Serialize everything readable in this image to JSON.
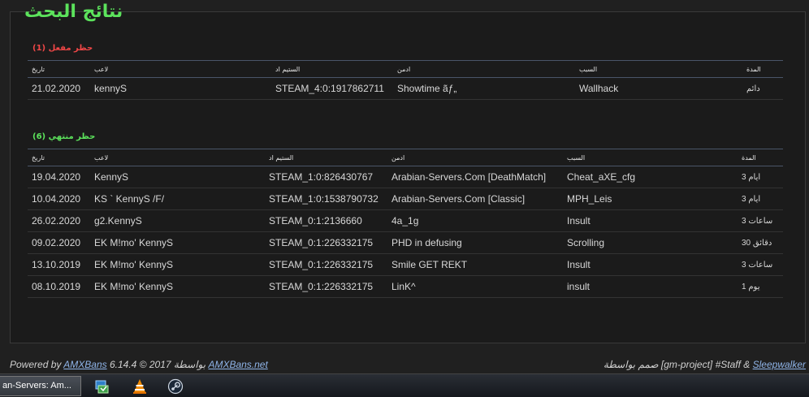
{
  "page_title": "نتائج البحث",
  "active_bans": {
    "title": "حظر مفعل (1)",
    "headers": [
      "تاريخ",
      "لاعب",
      "الستيم اد",
      "ادمن",
      "السبب",
      "المدة"
    ],
    "rows": [
      [
        "21.02.2020",
        "kennyS",
        "STEAM_4:0:1917862711",
        "Showtime ãƒ„",
        "Wallhack",
        "دائم"
      ]
    ]
  },
  "expired_bans": {
    "title": "حظر منتهي (6)",
    "headers": [
      "تاريخ",
      "لاعب",
      "الستيم اد",
      "ادمن",
      "السبب",
      "المدة"
    ],
    "rows": [
      [
        "19.04.2020",
        "KennyS",
        "STEAM_1:0:826430767",
        "Arabian-Servers.Com [DeathMatch]",
        "Cheat_aXE_cfg",
        "ايام 3"
      ],
      [
        "10.04.2020",
        "KS ` KennyS /F/",
        "STEAM_1:0:1538790732",
        "Arabian-Servers.Com [Classic]",
        "MPH_Leis",
        "ايام 3"
      ],
      [
        "26.02.2020",
        "g2.KennyS",
        "STEAM_0:1:2136660",
        "4a_1g",
        "Insult",
        "ساعات 3"
      ],
      [
        "09.02.2020",
        "EK M!mo' KennyS",
        "STEAM_0:1:226332175",
        "PHD in defusing",
        "Scrolling",
        "دقائق 30"
      ],
      [
        "13.10.2019",
        "EK M!mo' KennyS",
        "STEAM_0:1:226332175",
        "Smile GET REKT",
        "Insult",
        "ساعات 3"
      ],
      [
        "08.10.2019",
        "EK M!mo' KennyS",
        "STEAM_0:1:226332175",
        "LinK^",
        "insult",
        "يوم 1"
      ]
    ]
  },
  "footer": {
    "powered_by": "Powered by",
    "amxbans_link": "AMXBans",
    "version_text": "6.14.4 © 2017 بواسطة",
    "site_link": "AMXBans.net",
    "designed_text": "صمم بواسطة [gm-project] #Staff &",
    "designer_link": "Sleepwalker"
  },
  "taskbar": {
    "active_window": "an-Servers: Am..."
  },
  "colors": {
    "active_title": "#f04747",
    "expired_title": "#5ce35c",
    "link": "#8fb4e8"
  }
}
